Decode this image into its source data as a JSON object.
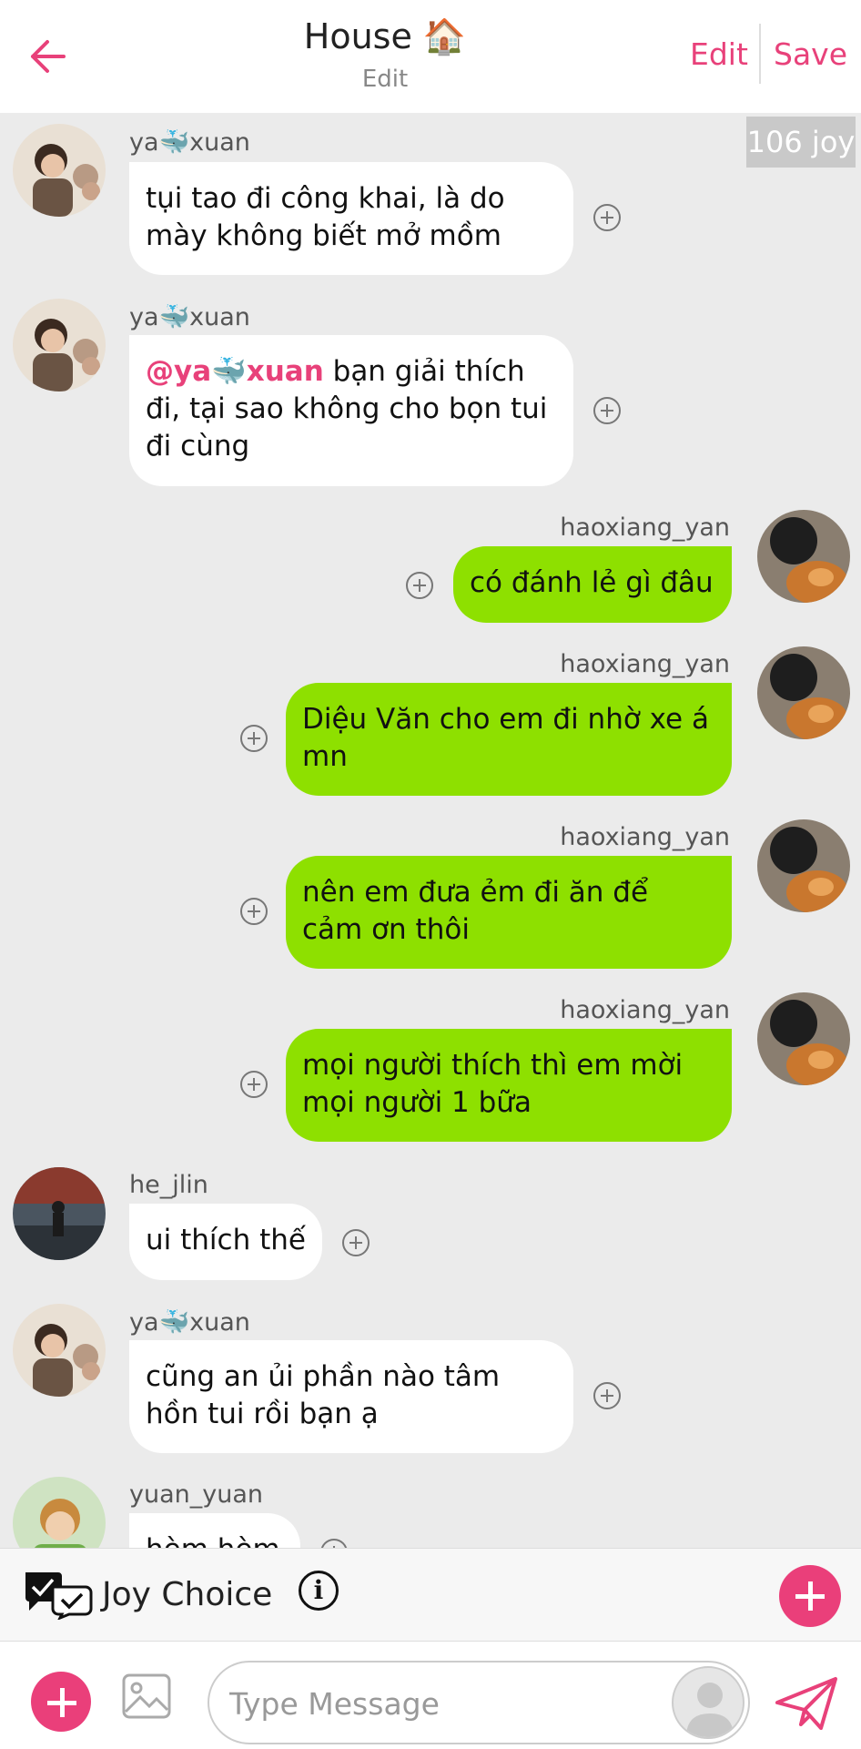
{
  "header": {
    "title": "House 🏠",
    "subtitle": "Edit",
    "edit_label": "Edit",
    "save_label": "Save"
  },
  "joy_badge": "106 joy",
  "messages": [
    {
      "user": "ya🐳xuan",
      "text": "tụi tao đi công khai, là do mày không biết mở mồm"
    },
    {
      "user": "ya🐳xuan",
      "mention": "@ya🐳xuan",
      "text": " bạn giải thích đi, tại sao không cho bọn tui đi cùng"
    },
    {
      "user": "haoxiang_yan",
      "text": "có đánh lẻ gì đâu"
    },
    {
      "user": "haoxiang_yan",
      "text": "Diệu Văn cho em đi nhờ xe á mn"
    },
    {
      "user": "haoxiang_yan",
      "text": "nên em đưa ẻm đi ăn để cảm ơn thôi"
    },
    {
      "user": "haoxiang_yan",
      "text": "mọi người thích thì em mời mọi người 1 bữa"
    },
    {
      "user": "he_jlin",
      "text": "ui thích thế"
    },
    {
      "user": "ya🐳xuan",
      "text": "cũng an ủi phần nào tâm hồn tui rồi bạn ạ"
    },
    {
      "user": "yuan_yuan",
      "text": "hèm hèm"
    }
  ],
  "joy_choice": {
    "label": "Joy Choice",
    "info": "i"
  },
  "input": {
    "placeholder": "Type Message"
  },
  "icons": {
    "back": "arrow-left-icon",
    "plus": "circle-plus-icon",
    "image": "image-icon",
    "send": "paper-plane-icon",
    "joy_choice": "double-check-bubble-icon"
  },
  "colors": {
    "accent": "#e8417a",
    "outgoing_bubble": "#8ee000",
    "incoming_bubble": "#ffffff",
    "background": "#ebebeb"
  }
}
